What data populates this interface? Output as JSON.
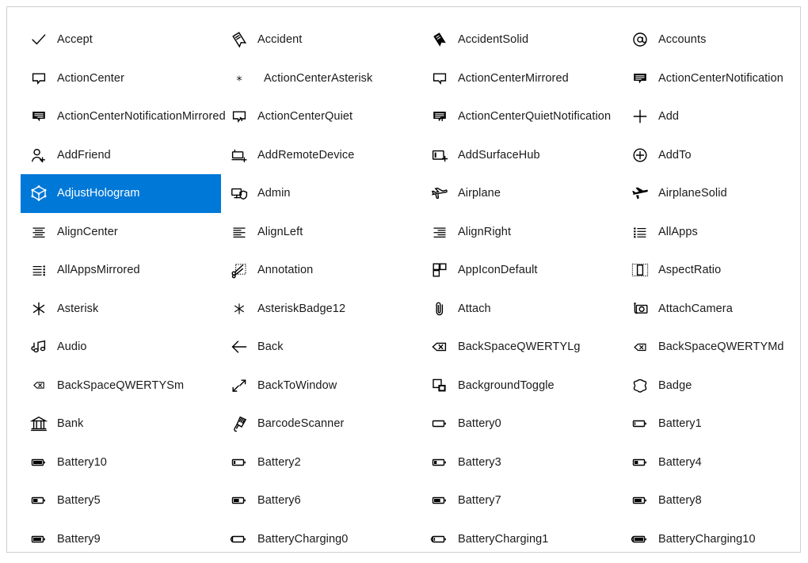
{
  "panel": {
    "name": "icon-gallery",
    "border_color": "#cfcfcf",
    "background": "#ffffff",
    "selection_color": "#0078d7",
    "selection_text_color": "#ffffff",
    "text_color": "#1a1a1a",
    "columns": 4,
    "rows": 14
  },
  "icons": [
    {
      "label": "Accept",
      "glyph": "accept-check-icon",
      "selected": false
    },
    {
      "label": "Accident",
      "glyph": "accident-icon",
      "selected": false
    },
    {
      "label": "AccidentSolid",
      "glyph": "accident-solid-icon",
      "selected": false
    },
    {
      "label": "Accounts",
      "glyph": "accounts-at-icon",
      "selected": false
    },
    {
      "label": "ActionCenter",
      "glyph": "action-center-icon",
      "selected": false
    },
    {
      "label": "ActionCenterAsterisk",
      "glyph": "action-center-asterisk-icon",
      "selected": false,
      "tiny": true
    },
    {
      "label": "ActionCenterMirrored",
      "glyph": "action-center-mirrored-icon",
      "selected": false
    },
    {
      "label": "ActionCenterNotification",
      "glyph": "action-center-notification-icon",
      "selected": false
    },
    {
      "label": "ActionCenterNotificationMirrored",
      "glyph": "action-center-notification-mirrored-icon",
      "selected": false
    },
    {
      "label": "ActionCenterQuiet",
      "glyph": "action-center-quiet-icon",
      "selected": false
    },
    {
      "label": "ActionCenterQuietNotification",
      "glyph": "action-center-quiet-notification-icon",
      "selected": false
    },
    {
      "label": "Add",
      "glyph": "add-plus-icon",
      "selected": false
    },
    {
      "label": "AddFriend",
      "glyph": "add-friend-icon",
      "selected": false
    },
    {
      "label": "AddRemoteDevice",
      "glyph": "add-remote-device-icon",
      "selected": false
    },
    {
      "label": "AddSurfaceHub",
      "glyph": "add-surface-hub-icon",
      "selected": false
    },
    {
      "label": "AddTo",
      "glyph": "add-to-circle-icon",
      "selected": false
    },
    {
      "label": "AdjustHologram",
      "glyph": "adjust-hologram-icon",
      "selected": true
    },
    {
      "label": "Admin",
      "glyph": "admin-shield-icon",
      "selected": false
    },
    {
      "label": "Airplane",
      "glyph": "airplane-icon",
      "selected": false
    },
    {
      "label": "AirplaneSolid",
      "glyph": "airplane-solid-icon",
      "selected": false
    },
    {
      "label": "AlignCenter",
      "glyph": "align-center-icon",
      "selected": false
    },
    {
      "label": "AlignLeft",
      "glyph": "align-left-icon",
      "selected": false
    },
    {
      "label": "AlignRight",
      "glyph": "align-right-icon",
      "selected": false
    },
    {
      "label": "AllApps",
      "glyph": "all-apps-icon",
      "selected": false
    },
    {
      "label": "AllAppsMirrored",
      "glyph": "all-apps-mirrored-icon",
      "selected": false
    },
    {
      "label": "Annotation",
      "glyph": "annotation-scissors-icon",
      "selected": false
    },
    {
      "label": "AppIconDefault",
      "glyph": "app-icon-default-icon",
      "selected": false
    },
    {
      "label": "AspectRatio",
      "glyph": "aspect-ratio-icon",
      "selected": false
    },
    {
      "label": "Asterisk",
      "glyph": "asterisk-icon",
      "selected": false
    },
    {
      "label": "AsteriskBadge12",
      "glyph": "asterisk-badge12-icon",
      "selected": false
    },
    {
      "label": "Attach",
      "glyph": "attach-paperclip-icon",
      "selected": false
    },
    {
      "label": "AttachCamera",
      "glyph": "attach-camera-icon",
      "selected": false
    },
    {
      "label": "Audio",
      "glyph": "audio-notes-icon",
      "selected": false
    },
    {
      "label": "Back",
      "glyph": "back-arrow-icon",
      "selected": false
    },
    {
      "label": "BackSpaceQWERTYLg",
      "glyph": "backspace-qwerty-lg-icon",
      "selected": false
    },
    {
      "label": "BackSpaceQWERTYMd",
      "glyph": "backspace-qwerty-md-icon",
      "selected": false
    },
    {
      "label": "BackSpaceQWERTYSm",
      "glyph": "backspace-qwerty-sm-icon",
      "selected": false
    },
    {
      "label": "BackToWindow",
      "glyph": "back-to-window-icon",
      "selected": false
    },
    {
      "label": "BackgroundToggle",
      "glyph": "background-toggle-icon",
      "selected": false
    },
    {
      "label": "Badge",
      "glyph": "badge-icon",
      "selected": false
    },
    {
      "label": "Bank",
      "glyph": "bank-icon",
      "selected": false
    },
    {
      "label": "BarcodeScanner",
      "glyph": "barcode-scanner-icon",
      "selected": false
    },
    {
      "label": "Battery0",
      "glyph": "battery0-icon",
      "selected": false
    },
    {
      "label": "Battery1",
      "glyph": "battery1-icon",
      "selected": false
    },
    {
      "label": "Battery10",
      "glyph": "battery10-icon",
      "selected": false
    },
    {
      "label": "Battery2",
      "glyph": "battery2-icon",
      "selected": false
    },
    {
      "label": "Battery3",
      "glyph": "battery3-icon",
      "selected": false
    },
    {
      "label": "Battery4",
      "glyph": "battery4-icon",
      "selected": false
    },
    {
      "label": "Battery5",
      "glyph": "battery5-icon",
      "selected": false
    },
    {
      "label": "Battery6",
      "glyph": "battery6-icon",
      "selected": false
    },
    {
      "label": "Battery7",
      "glyph": "battery7-icon",
      "selected": false
    },
    {
      "label": "Battery8",
      "glyph": "battery8-icon",
      "selected": false
    },
    {
      "label": "Battery9",
      "glyph": "battery9-icon",
      "selected": false
    },
    {
      "label": "BatteryCharging0",
      "glyph": "battery-charging0-icon",
      "selected": false
    },
    {
      "label": "BatteryCharging1",
      "glyph": "battery-charging1-icon",
      "selected": false
    },
    {
      "label": "BatteryCharging10",
      "glyph": "battery-charging10-icon",
      "selected": false
    }
  ]
}
